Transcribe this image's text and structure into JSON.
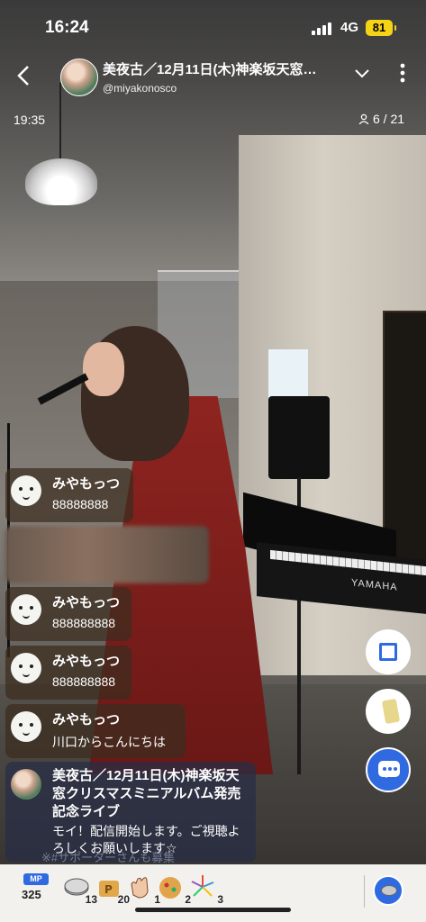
{
  "status_bar": {
    "time": "16:24",
    "network": "4G",
    "battery": "81"
  },
  "header": {
    "title": "美夜古／12月11日(木)神楽坂天窓…",
    "handle": "@miyakonosco",
    "elapsed": "19:35",
    "viewers": "6 / 21",
    "icons": {
      "back": "back-arrow-icon",
      "expand": "chevron-down-icon",
      "more": "more-vertical-icon",
      "viewers": "person-icon"
    }
  },
  "scene": {
    "keyboard_brand": "YAMAHA"
  },
  "chat": {
    "messages": [
      {
        "name": "みやもっつ",
        "text": "88888888"
      },
      {
        "name": "みやもっつ",
        "text": "888888888"
      },
      {
        "name": "みやもっつ",
        "text": "888888888"
      },
      {
        "name": "みやもっつ",
        "text": "川口からこんにちは"
      }
    ],
    "broadcaster": {
      "title": "美夜古／12月11日(木)神楽坂天窓クリスマスミニアルバム発売記念ライブ",
      "message": "モイ！配信開始します。ご視聴よろしくお願いします☆",
      "cutoff": "※#サポーターさんも募集"
    }
  },
  "side_buttons": [
    "screen-capture-icon",
    "drink-gift-icon",
    "comment-icon"
  ],
  "bottom_bar": {
    "mp_label": "MP",
    "mp_count": "325",
    "items": [
      {
        "icon": "coin-icon",
        "count": "13"
      },
      {
        "icon": "bread-icon",
        "count": "20"
      },
      {
        "icon": "clap-icon",
        "count": "1"
      },
      {
        "icon": "fried-item-icon",
        "count": "2"
      },
      {
        "icon": "fireworks-icon",
        "count": "3"
      }
    ]
  },
  "colors": {
    "accent": "#2f6ae0",
    "battery": "#f5d418",
    "dress": "#8e2420"
  }
}
